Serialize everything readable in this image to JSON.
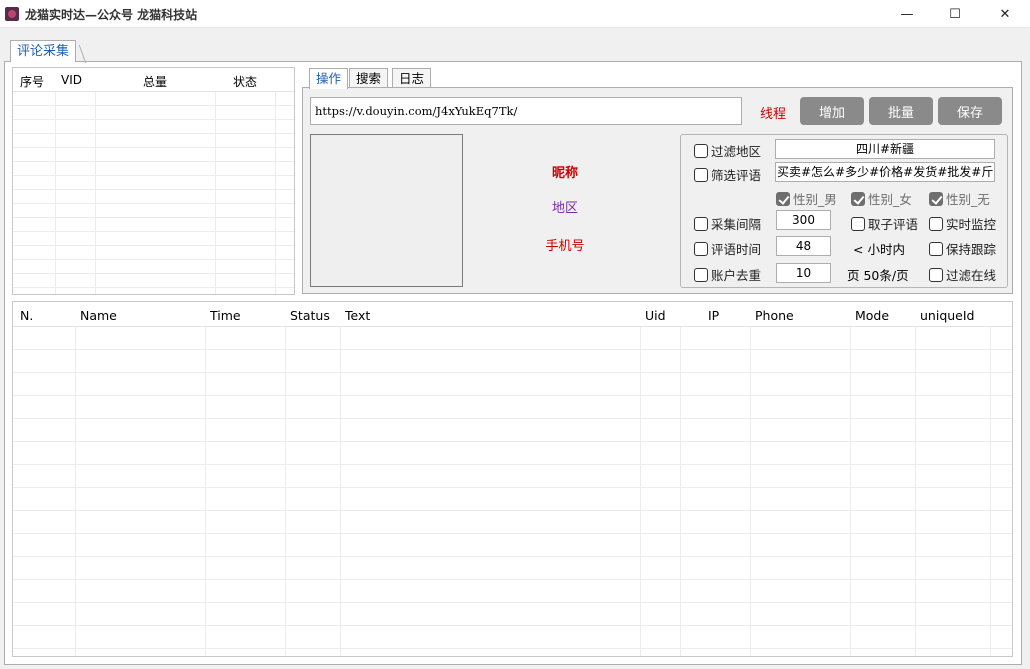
{
  "window": {
    "title": "龙猫实时达—公众号 龙猫科技站",
    "minimize": "—",
    "maximize": "☐",
    "close": "✕"
  },
  "main_tab": "评论采集",
  "left_list": {
    "columns": [
      "序号",
      "VID",
      "总量",
      "状态"
    ]
  },
  "sub_tabs": [
    "操作",
    "搜索",
    "日志"
  ],
  "operation": {
    "url": "https://v.douyin.com/J4xYukEq7Tk/",
    "thread_label": "线程",
    "buttons": [
      "增加",
      "批量",
      "保存"
    ],
    "nickname_label": "昵称",
    "region_label": "地区",
    "phone_label": "手机号"
  },
  "settings": {
    "filter_region_label": "过滤地区",
    "filter_region_value": "四川#新疆",
    "filter_comment_label": "筛选评语",
    "filter_comment_value": "买卖#怎么#多少#价格#发货#批发#斤#吨#",
    "gender_male": "性别_男",
    "gender_female": "性别_女",
    "gender_none": "性别_无",
    "interval_label": "采集间隔",
    "interval_value": "300",
    "sub_comment_label": "取子评语",
    "realtime_label": "实时监控",
    "comment_time_label": "评语时间",
    "comment_time_value": "48",
    "hours_suffix": "< 小时内",
    "keep_follow_label": "保持跟踪",
    "dedupe_label": "账户去重",
    "page_value": "10",
    "page_suffix": "页 50条/页",
    "filter_online_label": "过滤在线"
  },
  "results_table": {
    "columns": [
      "N.",
      "Name",
      "Time",
      "Status",
      "Text",
      "Uid",
      "IP",
      "Phone",
      "Mode",
      "uniqueId"
    ]
  },
  "colors": {
    "accent": "#1e5fb4",
    "red_label": "#cc0000",
    "purple_label": "#7a2ba8",
    "button_gray": "#8a8a8a"
  }
}
